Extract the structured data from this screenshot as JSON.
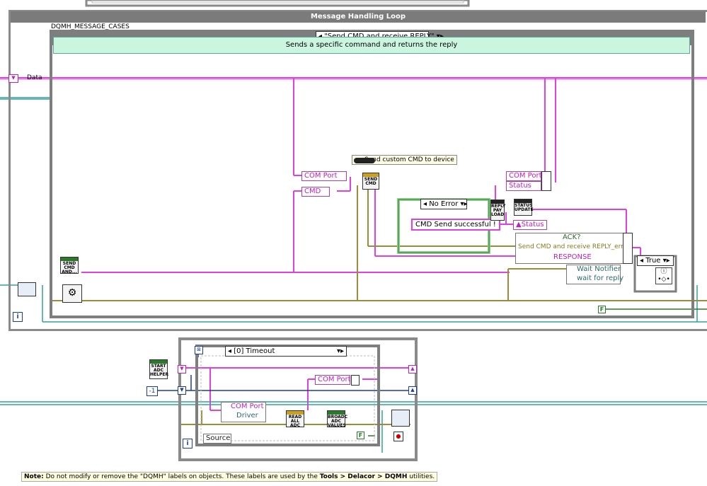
{
  "loops": {
    "message_handling_title": "Message Handling Loop"
  },
  "case_structure": {
    "label": "DQMH_MESSAGE_CASES",
    "selector": "\"Send CMD and receive REPLY\"",
    "comment": "Sends a specific command and returns the reply"
  },
  "labels": {
    "data": "Data",
    "send_custom_cmd": "Send custom CMD to device",
    "com_port_1": "COM Port",
    "cmd": "CMD",
    "com_port_2": "COM Port",
    "status": "Status",
    "no_error": "No Error",
    "cmd_send_successful": "CMD Send successful !",
    "status_local": "Status",
    "ack": "ACK?",
    "send_cmd_error": "Send CMD and receive REPLY_error",
    "response": "RESPONSE",
    "wait_notifier": "Wait Notifier",
    "wait_for_reply": "wait for reply",
    "true_case": "True",
    "false_const_1": "F",
    "iteration_1": "i",
    "minus_one": "-1",
    "timeout_case": "[0] Timeout",
    "com_port_3": "COM Port",
    "com_port_4": "COM Port",
    "driver": "Driver",
    "source": "Source",
    "false_const_2": "F",
    "iteration_2": "i"
  },
  "nodes": {
    "send_cmd_small": "SEND CMD AND...",
    "send_cmd": "SEND CMD",
    "reply_payload": "REPLY PAY LOAD",
    "status_update": "STATUS UPDATE",
    "start_adc_helper": "START ADC HELPER",
    "read_all_adc": "READ ALL ADC",
    "broadc_adc_values": "BROADC ADC VALUES"
  },
  "note": {
    "prefix": "Note:",
    "text_1": " Do not modify or remove the \"DQMH\" labels on objects. These labels are used by the ",
    "menu_path": "Tools > Delacor > DQMH",
    "text_2": " utilities."
  },
  "colors": {
    "string_wire": "#e040e0",
    "cluster_wire": "#a08a3a",
    "refnum_wire": "#30a0a0",
    "blue_wire": "#1c3c9c",
    "comment_bg": "#ccf5e0",
    "frame_gray": "#7e7e7e"
  }
}
